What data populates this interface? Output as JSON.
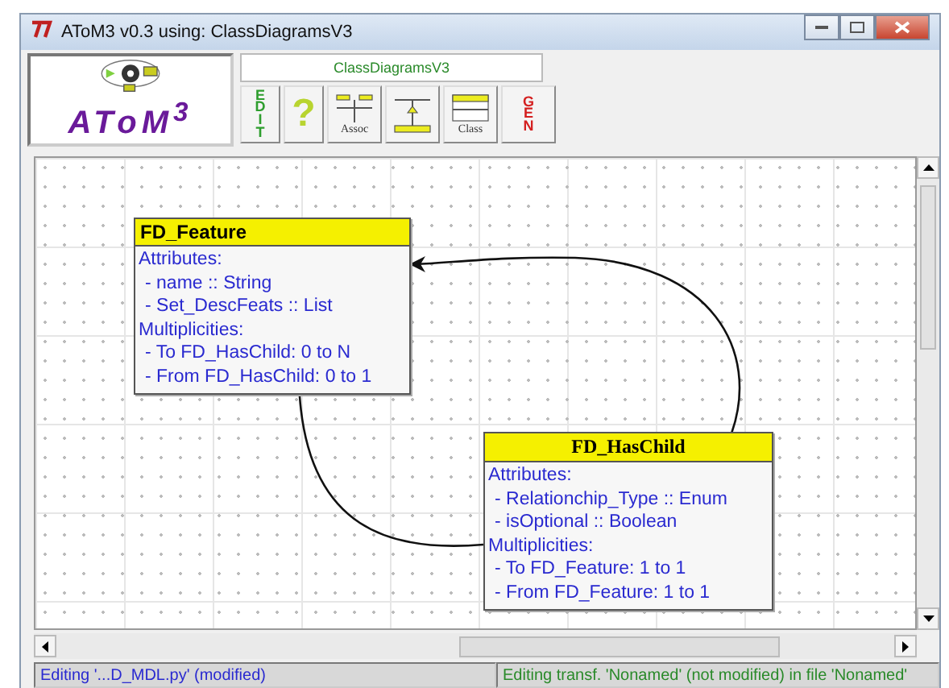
{
  "window": {
    "title": "AToM3 v0.3 using: ClassDiagramsV3"
  },
  "logo": {
    "text": "AToM$^{3}$"
  },
  "formalism": {
    "name": "ClassDiagramsV3"
  },
  "tools": [
    {
      "kind": "vertical",
      "label": "EDIT",
      "color": "#2e9e2e"
    },
    {
      "kind": "glyph",
      "label": "?",
      "color": "#b8d430"
    },
    {
      "kind": "assoc",
      "label": "Assoc"
    },
    {
      "kind": "inherit"
    },
    {
      "kind": "class",
      "label": "Class"
    },
    {
      "kind": "vertical",
      "label": "GEN",
      "color": "#d42020"
    }
  ],
  "classes": [
    {
      "name": "FD_Feature",
      "serif": false,
      "sections": [
        {
          "title": "Attributes:",
          "items": [
            "- name :: String",
            "- Set_DescFeats :: List"
          ]
        },
        {
          "title": "Multiplicities:",
          "items": [
            "- To FD_HasChild: 0 to N",
            "- From FD_HasChild: 0 to 1"
          ]
        }
      ]
    },
    {
      "name": "FD_HasChild",
      "serif": true,
      "sections": [
        {
          "title": "Attributes:",
          "items": [
            "- Relationchip_Type :: Enum",
            "- isOptional :: Boolean"
          ]
        },
        {
          "title": "Multiplicities:",
          "items": [
            "- To FD_Feature: 1 to 1",
            "- From FD_Feature: 1 to 1"
          ]
        }
      ]
    }
  ],
  "status_bar": {
    "left": "Editing '...D_MDL.py' (modified)",
    "right": "Editing transf. 'Nonamed' (not modified) in file 'Nonamed'"
  }
}
